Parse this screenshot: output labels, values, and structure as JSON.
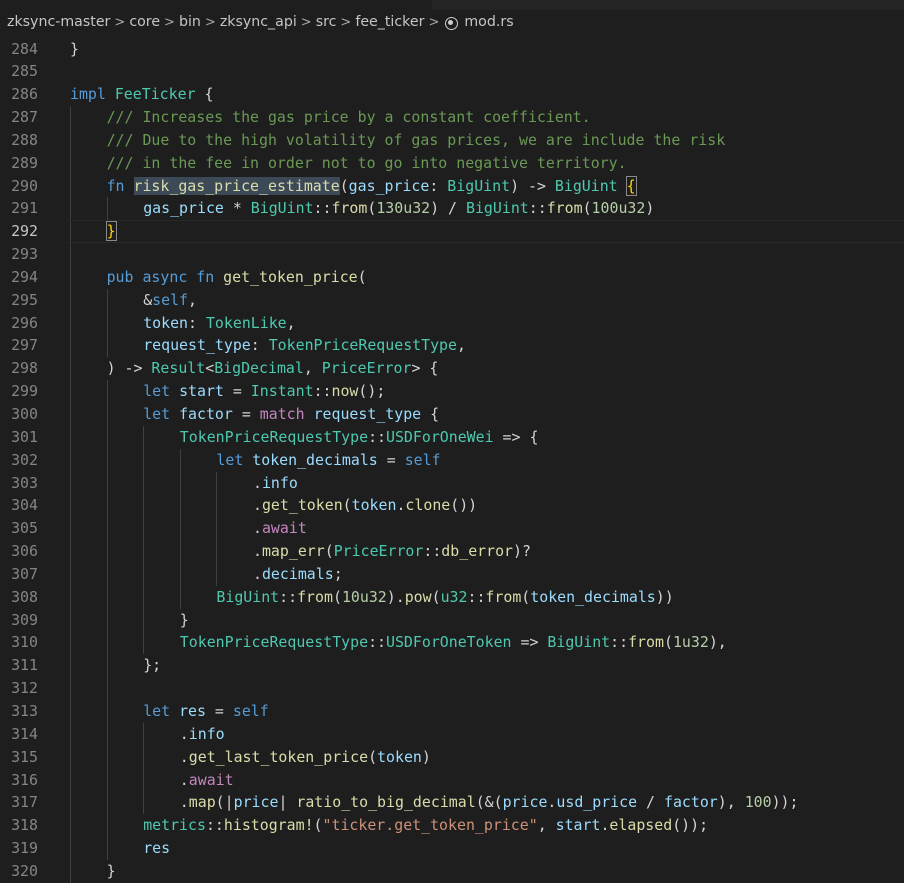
{
  "breadcrumb": {
    "segments": [
      "zksync-master",
      "core",
      "bin",
      "zksync_api",
      "src",
      "fee_ticker"
    ],
    "file": "mod.rs",
    "separator": ">",
    "file_icon": "rust-file-icon"
  },
  "editor": {
    "language": "rust",
    "current_line": 292,
    "colors": {
      "keyword": "#569cd6",
      "type": "#4ec9b0",
      "function": "#dcdcaa",
      "variable": "#9cdcfe",
      "number": "#b5cea8",
      "string": "#ce9178",
      "comment": "#6a9955",
      "control": "#c586c0",
      "plain": "#d4d4d4"
    },
    "lines": [
      {
        "n": "284",
        "indent": 0,
        "tokens": [
          [
            "}",
            "txt"
          ]
        ]
      },
      {
        "n": "285",
        "indent": 0,
        "tokens": []
      },
      {
        "n": "286",
        "indent": 0,
        "tokens": [
          [
            "impl",
            "kw"
          ],
          [
            " ",
            "txt"
          ],
          [
            "FeeTicker",
            "ty"
          ],
          [
            " {",
            "txt"
          ]
        ]
      },
      {
        "n": "287",
        "indent": 1,
        "tokens": [
          [
            "/// Increases the gas price by a constant coefficient.",
            "com"
          ]
        ]
      },
      {
        "n": "288",
        "indent": 1,
        "tokens": [
          [
            "/// Due to the high volatility of gas prices, we are include the risk",
            "com"
          ]
        ]
      },
      {
        "n": "289",
        "indent": 1,
        "tokens": [
          [
            "/// in the fee in order not to go into negative territory.",
            "com"
          ]
        ]
      },
      {
        "n": "290",
        "indent": 1,
        "tokens": [
          [
            "fn",
            "kw"
          ],
          [
            " ",
            "txt"
          ],
          [
            "risk_gas_price_estimate",
            "hl"
          ],
          [
            "(",
            "txt"
          ],
          [
            "gas_price",
            "var"
          ],
          [
            ": ",
            "txt"
          ],
          [
            "BigUint",
            "ty"
          ],
          [
            ") -> ",
            "txt"
          ],
          [
            "BigUint",
            "ty"
          ],
          [
            " ",
            "txt"
          ],
          [
            "{",
            "br"
          ]
        ]
      },
      {
        "n": "291",
        "indent": 2,
        "tokens": [
          [
            "gas_price",
            "var"
          ],
          [
            " * ",
            "txt"
          ],
          [
            "BigUint",
            "ty"
          ],
          [
            "::",
            "txt"
          ],
          [
            "from",
            "fn"
          ],
          [
            "(",
            "txt"
          ],
          [
            "130u32",
            "num"
          ],
          [
            ") / ",
            "txt"
          ],
          [
            "BigUint",
            "ty"
          ],
          [
            "::",
            "txt"
          ],
          [
            "from",
            "fn"
          ],
          [
            "(",
            "txt"
          ],
          [
            "100u32",
            "num"
          ],
          [
            ")",
            "txt"
          ]
        ]
      },
      {
        "n": "292",
        "indent": 1,
        "tokens": [
          [
            "}",
            "br"
          ]
        ]
      },
      {
        "n": "293",
        "indent": 0,
        "tokens": []
      },
      {
        "n": "294",
        "indent": 1,
        "tokens": [
          [
            "pub",
            "kw"
          ],
          [
            " ",
            "txt"
          ],
          [
            "async",
            "kw"
          ],
          [
            " ",
            "txt"
          ],
          [
            "fn",
            "kw"
          ],
          [
            " ",
            "txt"
          ],
          [
            "get_token_price",
            "fn"
          ],
          [
            "(",
            "txt"
          ]
        ]
      },
      {
        "n": "295",
        "indent": 2,
        "tokens": [
          [
            "&",
            "txt"
          ],
          [
            "self",
            "kw"
          ],
          [
            ",",
            "txt"
          ]
        ]
      },
      {
        "n": "296",
        "indent": 2,
        "tokens": [
          [
            "token",
            "var"
          ],
          [
            ": ",
            "txt"
          ],
          [
            "TokenLike",
            "ty"
          ],
          [
            ",",
            "txt"
          ]
        ]
      },
      {
        "n": "297",
        "indent": 2,
        "tokens": [
          [
            "request_type",
            "var"
          ],
          [
            ": ",
            "txt"
          ],
          [
            "TokenPriceRequestType",
            "ty"
          ],
          [
            ",",
            "txt"
          ]
        ]
      },
      {
        "n": "298",
        "indent": 1,
        "tokens": [
          [
            ") -> ",
            "txt"
          ],
          [
            "Result",
            "ty"
          ],
          [
            "<",
            "txt"
          ],
          [
            "BigDecimal",
            "ty"
          ],
          [
            ", ",
            "txt"
          ],
          [
            "PriceError",
            "ty"
          ],
          [
            "> {",
            "txt"
          ]
        ]
      },
      {
        "n": "299",
        "indent": 2,
        "tokens": [
          [
            "let",
            "kw"
          ],
          [
            " ",
            "txt"
          ],
          [
            "start",
            "var"
          ],
          [
            " = ",
            "txt"
          ],
          [
            "Instant",
            "ty"
          ],
          [
            "::",
            "txt"
          ],
          [
            "now",
            "fn"
          ],
          [
            "();",
            "txt"
          ]
        ]
      },
      {
        "n": "300",
        "indent": 2,
        "tokens": [
          [
            "let",
            "kw"
          ],
          [
            " ",
            "txt"
          ],
          [
            "factor",
            "var"
          ],
          [
            " = ",
            "txt"
          ],
          [
            "match",
            "ctl"
          ],
          [
            " ",
            "txt"
          ],
          [
            "request_type",
            "var"
          ],
          [
            " {",
            "txt"
          ]
        ]
      },
      {
        "n": "301",
        "indent": 3,
        "tokens": [
          [
            "TokenPriceRequestType",
            "ty"
          ],
          [
            "::",
            "txt"
          ],
          [
            "USDForOneWei",
            "ty"
          ],
          [
            " => {",
            "txt"
          ]
        ]
      },
      {
        "n": "302",
        "indent": 4,
        "tokens": [
          [
            "let",
            "kw"
          ],
          [
            " ",
            "txt"
          ],
          [
            "token_decimals",
            "var"
          ],
          [
            " = ",
            "txt"
          ],
          [
            "self",
            "kw"
          ]
        ]
      },
      {
        "n": "303",
        "indent": 5,
        "tokens": [
          [
            ".",
            "txt"
          ],
          [
            "info",
            "var"
          ]
        ]
      },
      {
        "n": "304",
        "indent": 5,
        "tokens": [
          [
            ".",
            "txt"
          ],
          [
            "get_token",
            "fn"
          ],
          [
            "(",
            "txt"
          ],
          [
            "token",
            "var"
          ],
          [
            ".",
            "txt"
          ],
          [
            "clone",
            "fn"
          ],
          [
            "())",
            "txt"
          ]
        ]
      },
      {
        "n": "305",
        "indent": 5,
        "tokens": [
          [
            ".",
            "txt"
          ],
          [
            "await",
            "ctl"
          ]
        ]
      },
      {
        "n": "306",
        "indent": 5,
        "tokens": [
          [
            ".",
            "txt"
          ],
          [
            "map_err",
            "fn"
          ],
          [
            "(",
            "txt"
          ],
          [
            "PriceError",
            "ty"
          ],
          [
            "::",
            "txt"
          ],
          [
            "db_error",
            "fn"
          ],
          [
            ")?",
            "txt"
          ]
        ]
      },
      {
        "n": "307",
        "indent": 5,
        "tokens": [
          [
            ".",
            "txt"
          ],
          [
            "decimals",
            "var"
          ],
          [
            ";",
            "txt"
          ]
        ]
      },
      {
        "n": "308",
        "indent": 4,
        "tokens": [
          [
            "BigUint",
            "ty"
          ],
          [
            "::",
            "txt"
          ],
          [
            "from",
            "fn"
          ],
          [
            "(",
            "txt"
          ],
          [
            "10u32",
            "num"
          ],
          [
            ").",
            "txt"
          ],
          [
            "pow",
            "fn"
          ],
          [
            "(",
            "txt"
          ],
          [
            "u32",
            "ty"
          ],
          [
            "::",
            "txt"
          ],
          [
            "from",
            "fn"
          ],
          [
            "(",
            "txt"
          ],
          [
            "token_decimals",
            "var"
          ],
          [
            "))",
            "txt"
          ]
        ]
      },
      {
        "n": "309",
        "indent": 3,
        "tokens": [
          [
            "}",
            "txt"
          ]
        ]
      },
      {
        "n": "310",
        "indent": 3,
        "tokens": [
          [
            "TokenPriceRequestType",
            "ty"
          ],
          [
            "::",
            "txt"
          ],
          [
            "USDForOneToken",
            "ty"
          ],
          [
            " => ",
            "txt"
          ],
          [
            "BigUint",
            "ty"
          ],
          [
            "::",
            "txt"
          ],
          [
            "from",
            "fn"
          ],
          [
            "(",
            "txt"
          ],
          [
            "1u32",
            "num"
          ],
          [
            "),",
            "txt"
          ]
        ]
      },
      {
        "n": "311",
        "indent": 2,
        "tokens": [
          [
            "};",
            "txt"
          ]
        ]
      },
      {
        "n": "312",
        "indent": 0,
        "tokens": []
      },
      {
        "n": "313",
        "indent": 2,
        "tokens": [
          [
            "let",
            "kw"
          ],
          [
            " ",
            "txt"
          ],
          [
            "res",
            "var"
          ],
          [
            " = ",
            "txt"
          ],
          [
            "self",
            "kw"
          ]
        ]
      },
      {
        "n": "314",
        "indent": 3,
        "tokens": [
          [
            ".",
            "txt"
          ],
          [
            "info",
            "var"
          ]
        ]
      },
      {
        "n": "315",
        "indent": 3,
        "tokens": [
          [
            ".",
            "txt"
          ],
          [
            "get_last_token_price",
            "fn"
          ],
          [
            "(",
            "txt"
          ],
          [
            "token",
            "var"
          ],
          [
            ")",
            "txt"
          ]
        ]
      },
      {
        "n": "316",
        "indent": 3,
        "tokens": [
          [
            ".",
            "txt"
          ],
          [
            "await",
            "ctl"
          ]
        ]
      },
      {
        "n": "317",
        "indent": 3,
        "tokens": [
          [
            ".",
            "txt"
          ],
          [
            "map",
            "fn"
          ],
          [
            "(|",
            "txt"
          ],
          [
            "price",
            "var"
          ],
          [
            "| ",
            "txt"
          ],
          [
            "ratio_to_big_decimal",
            "fn"
          ],
          [
            "(&(",
            "txt"
          ],
          [
            "price",
            "var"
          ],
          [
            ".",
            "txt"
          ],
          [
            "usd_price",
            "var"
          ],
          [
            " / ",
            "txt"
          ],
          [
            "factor",
            "var"
          ],
          [
            "), ",
            "txt"
          ],
          [
            "100",
            "num"
          ],
          [
            "));",
            "txt"
          ]
        ]
      },
      {
        "n": "318",
        "indent": 2,
        "tokens": [
          [
            "metrics",
            "ty"
          ],
          [
            "::",
            "txt"
          ],
          [
            "histogram!",
            "fn"
          ],
          [
            "(",
            "txt"
          ],
          [
            "\"ticker.get_token_price\"",
            "str"
          ],
          [
            ", ",
            "txt"
          ],
          [
            "start",
            "var"
          ],
          [
            ".",
            "txt"
          ],
          [
            "elapsed",
            "fn"
          ],
          [
            "());",
            "txt"
          ]
        ]
      },
      {
        "n": "319",
        "indent": 2,
        "tokens": [
          [
            "res",
            "var"
          ]
        ]
      },
      {
        "n": "320",
        "indent": 1,
        "tokens": [
          [
            "}",
            "txt"
          ]
        ]
      }
    ]
  }
}
